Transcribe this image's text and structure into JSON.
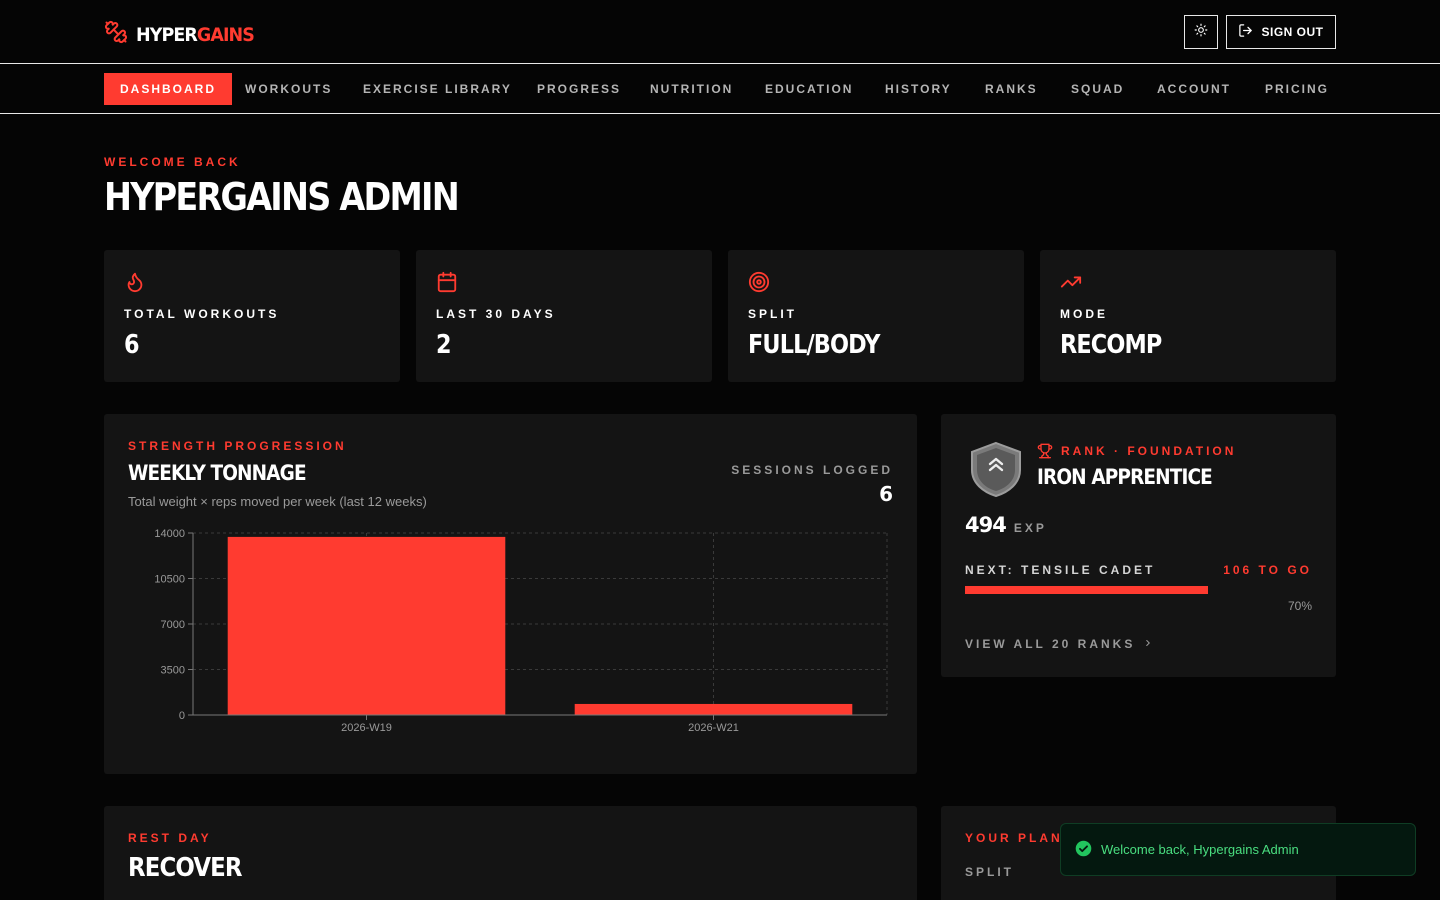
{
  "brand": {
    "name_part1": "HYPER",
    "name_part2": "GAINS"
  },
  "header": {
    "signout_label": "SIGN OUT"
  },
  "nav": {
    "items": [
      {
        "label": "DASHBOARD",
        "active": true
      },
      {
        "label": "WORKOUTS"
      },
      {
        "label": "EXERCISE LIBRARY"
      },
      {
        "label": "PROGRESS"
      },
      {
        "label": "NUTRITION"
      },
      {
        "label": "EDUCATION"
      },
      {
        "label": "HISTORY"
      },
      {
        "label": "RANKS"
      },
      {
        "label": "SQUAD"
      },
      {
        "label": "ACCOUNT"
      },
      {
        "label": "PRICING"
      }
    ]
  },
  "welcome": {
    "eyebrow": "WELCOME BACK",
    "name": "HYPERGAINS ADMIN"
  },
  "stats": [
    {
      "icon": "flame-icon",
      "label": "TOTAL WORKOUTS",
      "value": "6"
    },
    {
      "icon": "calendar-icon",
      "label": "LAST 30 DAYS",
      "value": "2"
    },
    {
      "icon": "target-icon",
      "label": "SPLIT",
      "value": "FULL/BODY"
    },
    {
      "icon": "trending-up-icon",
      "label": "MODE",
      "value": "RECOMP"
    }
  ],
  "strength": {
    "eyebrow": "STRENGTH PROGRESSION",
    "title": "WEEKLY TONNAGE",
    "subtitle": "Total weight × reps moved per week (last 12 weeks)",
    "sessions_label": "SESSIONS LOGGED",
    "sessions_value": "6"
  },
  "chart_data": {
    "type": "bar",
    "title": "",
    "xlabel": "",
    "ylabel": "",
    "categories": [
      "2026-W19",
      "2026-W21"
    ],
    "values": [
      13700,
      850
    ],
    "ylim": [
      0,
      14000
    ],
    "yticks": [
      0,
      3500,
      7000,
      10500,
      14000
    ],
    "grid": true,
    "color": "#ff3b30"
  },
  "rank": {
    "eyebrow": "RANK · FOUNDATION",
    "title": "IRON APPRENTICE",
    "exp_value": "494",
    "exp_unit": "EXP",
    "next_label": "NEXT: TENSILE CADET",
    "to_go": "106 TO GO",
    "progress_percent": 70,
    "progress_text": "70%",
    "view_all": "VIEW ALL 20 RANKS"
  },
  "rest": {
    "eyebrow": "REST DAY",
    "title": "RECOVER"
  },
  "plan": {
    "eyebrow": "YOUR PLAN",
    "split_label": "SPLIT"
  },
  "toast": {
    "message": "Welcome back, Hypergains Admin"
  },
  "colors": {
    "accent": "#ff3b30",
    "panel": "#141414",
    "background": "#050505",
    "success": "#4ade80"
  }
}
